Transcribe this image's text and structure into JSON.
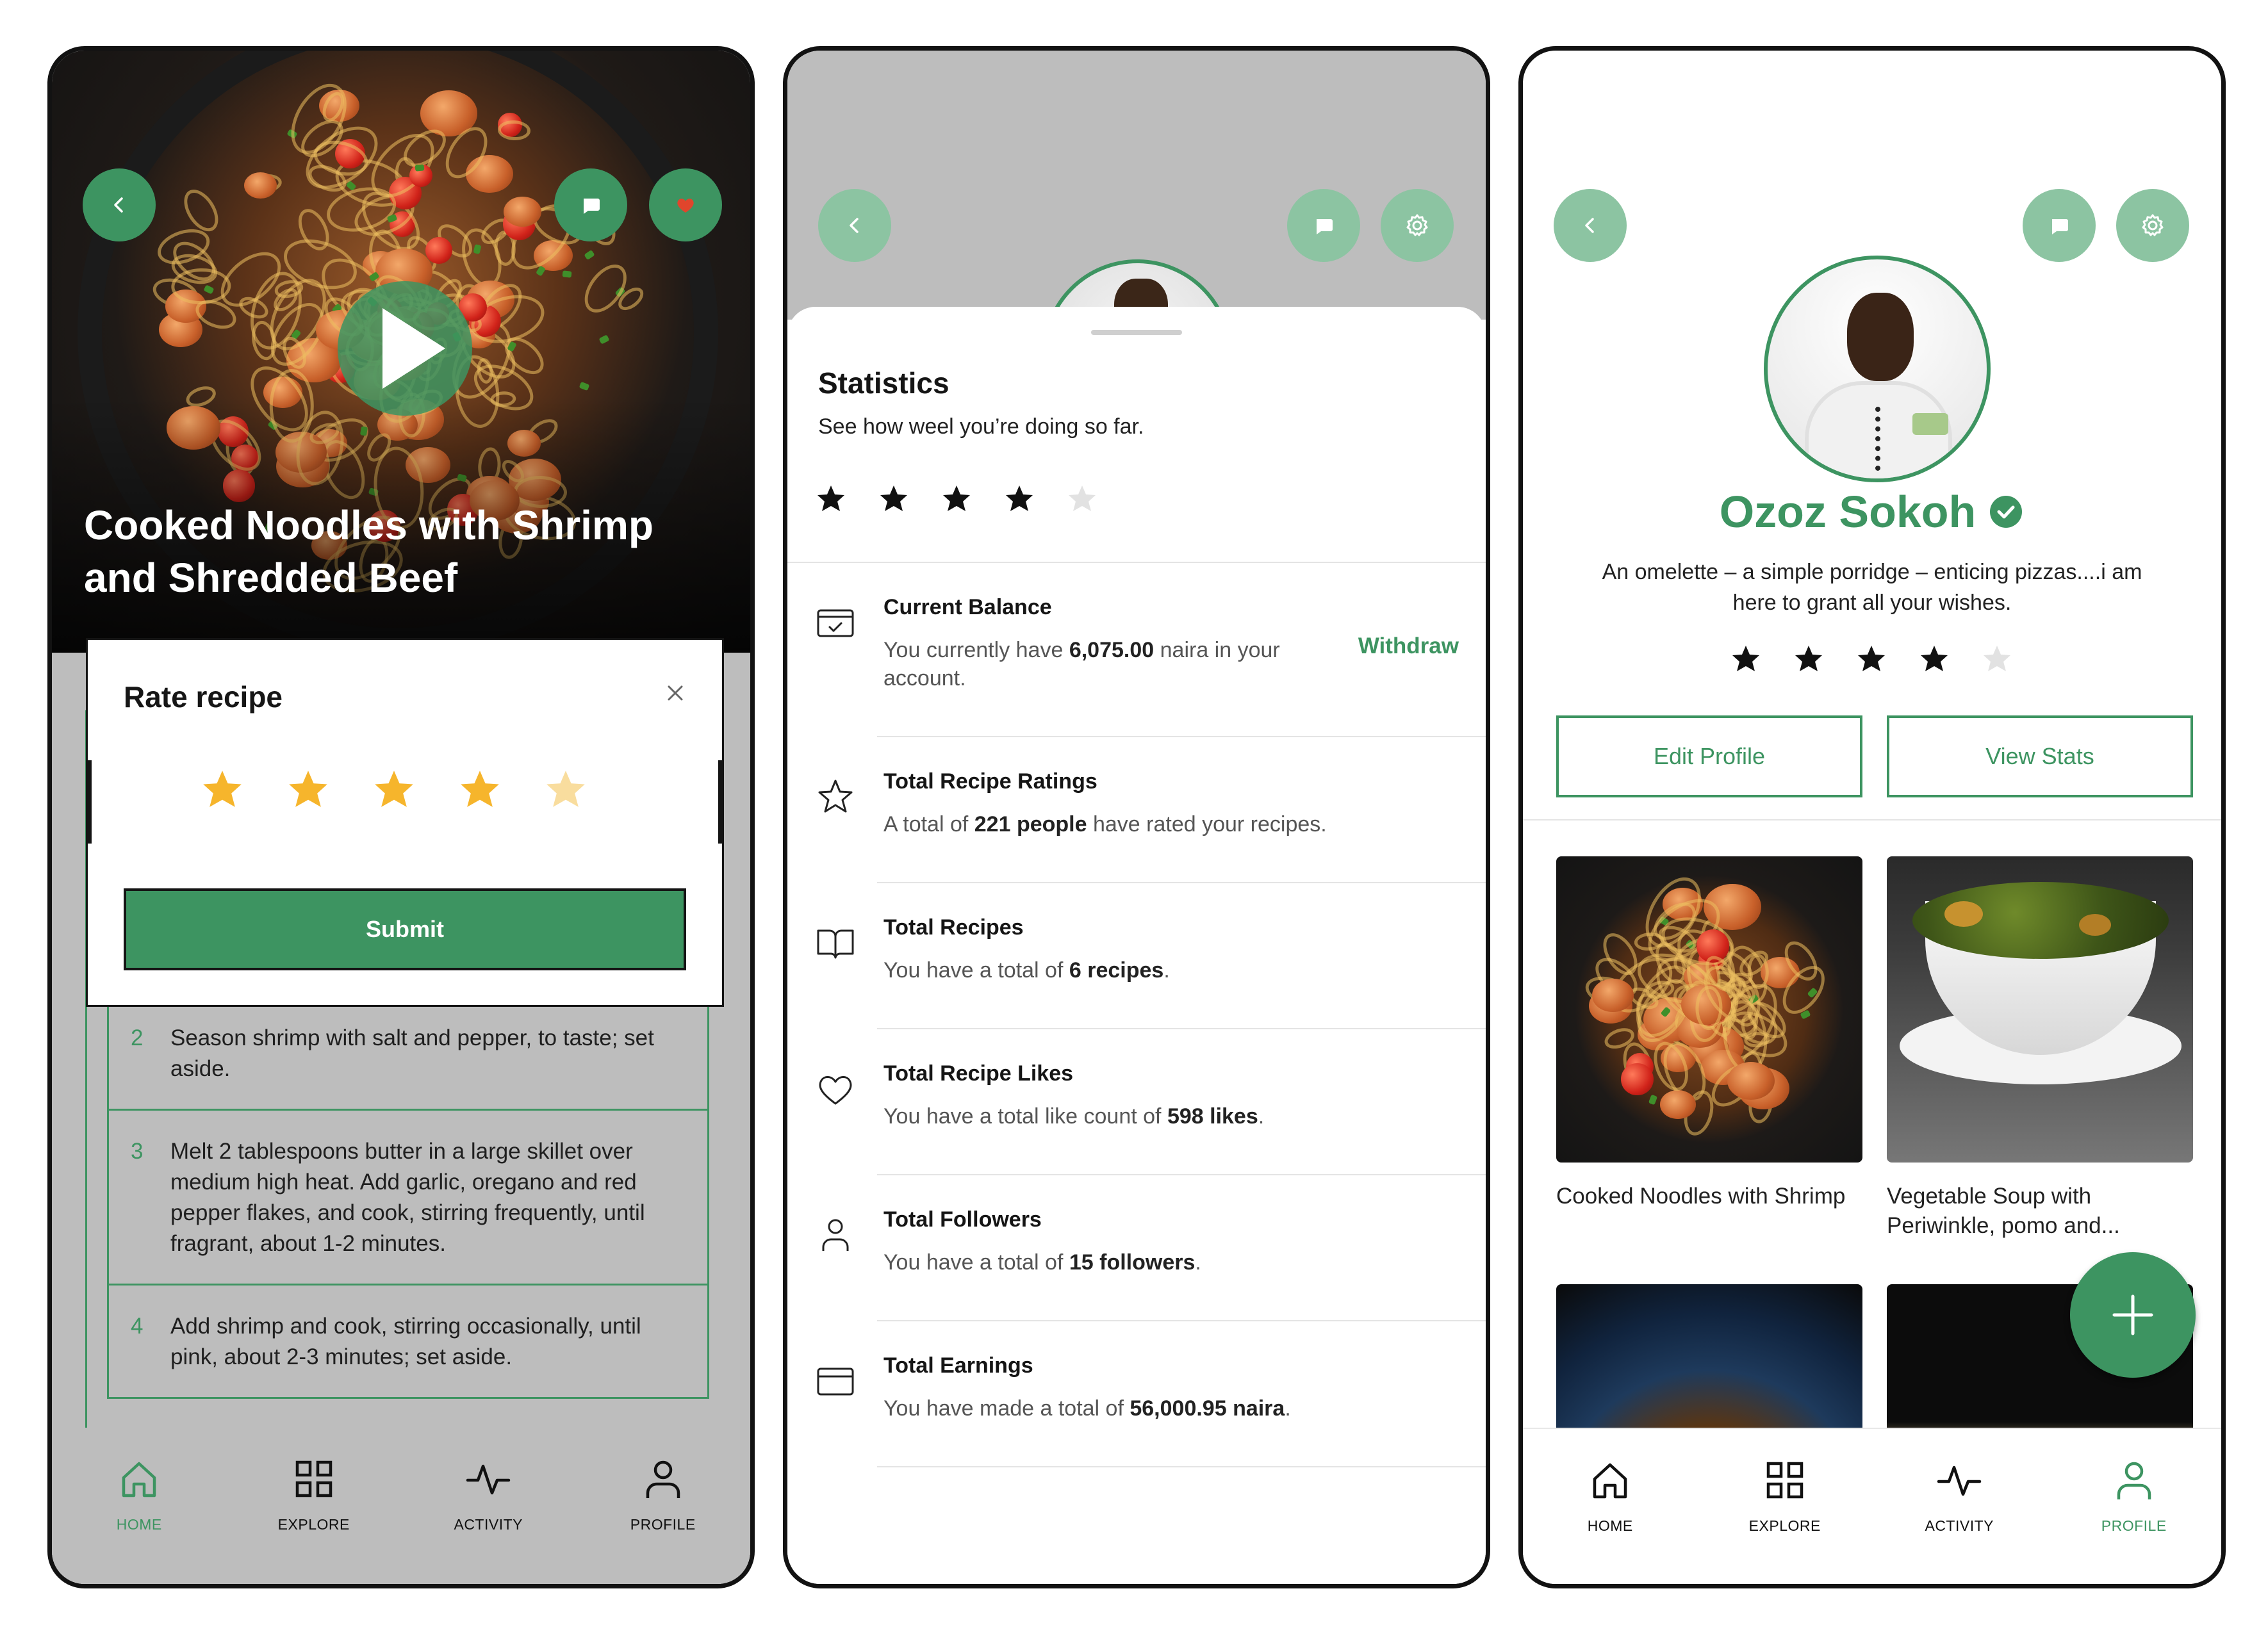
{
  "colors": {
    "accent": "#3d9461",
    "accent_light": "#8cc4a2",
    "star_gold": "#f6b52c",
    "star_faint": "#f9dd9e",
    "dark": "#121212",
    "muted_bg": "#bdbdbd"
  },
  "nav": {
    "home": "HOME",
    "explore": "EXPLORE",
    "activity": "ACTIVITY",
    "profile": "PROFILE"
  },
  "recipe_screen": {
    "title": "Cooked Noodles with Shrimp and Shredded Beef",
    "modal": {
      "title": "Rate recipe",
      "submit_label": "Submit",
      "rating_selected": 4,
      "rating_max": 5
    },
    "steps": [
      {
        "num": "2",
        "text": "Season shrimp with salt and pepper, to taste; set aside."
      },
      {
        "num": "3",
        "text": "Melt 2 tablespoons butter in a large skillet over medium high heat. Add garlic, oregano and red pepper flakes, and cook, stirring frequently, until fragrant, about 1-2 minutes."
      },
      {
        "num": "4",
        "text": "Add shrimp and cook, stirring occasionally, until pink, about 2-3 minutes; set aside."
      }
    ],
    "active_tab": "home"
  },
  "stats_screen": {
    "title": "Statistics",
    "subtitle": "See how weel you’re doing so far.",
    "rating": 4,
    "rating_max": 5,
    "rows": [
      {
        "icon": "card-check-icon",
        "label": "Current Balance",
        "pre": "You currently have ",
        "value": "6,075.00",
        "post": " naira in your account.",
        "action": "Withdraw"
      },
      {
        "icon": "star-outline-icon",
        "label": "Total Recipe Ratings",
        "pre": "A total of ",
        "value": "221 people",
        "post": " have rated your recipes."
      },
      {
        "icon": "book-icon",
        "label": "Total Recipes",
        "pre": "You have a total of ",
        "value": "6 recipes",
        "post": "."
      },
      {
        "icon": "heart-icon",
        "label": "Total Recipe Likes",
        "pre": "You have a total like count of ",
        "value": "598 likes",
        "post": "."
      },
      {
        "icon": "user-icon",
        "label": "Total Followers",
        "pre": "You have a total of ",
        "value": "15 followers",
        "post": "."
      },
      {
        "icon": "card-icon",
        "label": "Total Earnings",
        "pre": "You have made a total of ",
        "value": "56,000.95 naira",
        "post": "."
      }
    ]
  },
  "profile_screen": {
    "name": "Ozoz Sokoh",
    "bio": "An omelette – a simple porridge – enticing pizzas....i am here to grant all your wishes.",
    "rating": 4,
    "rating_max": 5,
    "edit_label": "Edit Profile",
    "stats_label": "View Stats",
    "recipes": [
      {
        "caption": "Cooked Noodles with Shrimp"
      },
      {
        "caption": "Vegetable Soup with Periwinkle, pomo and..."
      },
      {
        "caption": ""
      },
      {
        "caption": ""
      }
    ],
    "active_tab": "profile"
  }
}
